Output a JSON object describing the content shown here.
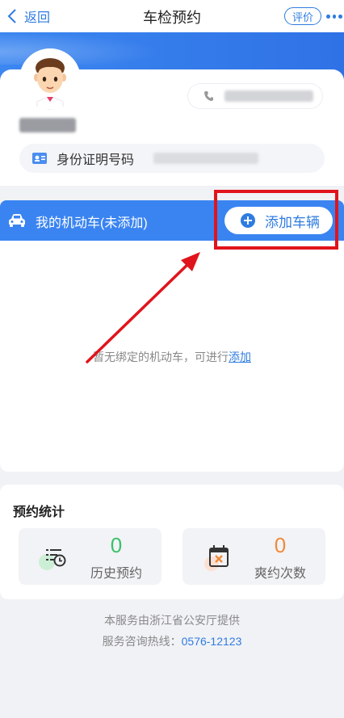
{
  "nav": {
    "back_label": "返回",
    "title": "车检预约",
    "rate_label": "评价",
    "more_icon": "more-dots-icon"
  },
  "profile": {
    "avatar_icon": "avatar-boy-icon",
    "phone_icon": "phone-icon",
    "id_icon": "id-card-icon",
    "id_label": "身份证明号码"
  },
  "vehicles": {
    "title": "我的机动车(未添加)",
    "add_button_label": "添加车辆",
    "empty_text": "暂无绑定的机动车，可进行",
    "empty_link": "添加"
  },
  "stats": {
    "title": "预约统计",
    "history": {
      "value": "0",
      "label": "历史预约"
    },
    "missed": {
      "value": "0",
      "label": "爽约次数"
    }
  },
  "footer": {
    "provider": "本服务由浙江省公安厅提供",
    "hotline_label": "服务咨询热线：",
    "hotline_number": "0576-12123"
  },
  "colors": {
    "primary": "#2f7ce0",
    "header_blue": "#3a84f1",
    "annotation_red": "#e0141c",
    "history_green": "#3ac16a",
    "missed_orange": "#f08a3a"
  }
}
